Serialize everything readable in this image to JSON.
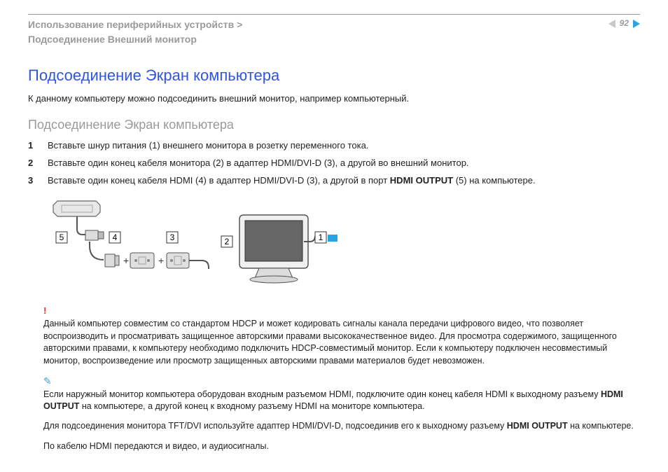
{
  "header": {
    "breadcrumb_line1": "Использование периферийных устройств >",
    "breadcrumb_line2": "Подсоединение Внешний монитор",
    "page_number": "92"
  },
  "title": "Подсоединение Экран компьютера",
  "intro": "К данному компьютеру можно подсоединить внешний монитор, например компьютерный.",
  "subtitle": "Подсоединение Экран компьютера",
  "steps": [
    {
      "n": "1",
      "text": "Вставьте шнур питания (1) внешнего монитора в розетку переменного тока."
    },
    {
      "n": "2",
      "text": "Вставьте один конец кабеля монитора (2) в адаптер HDMI/DVI-D (3), а другой во внешний монитор."
    },
    {
      "n": "3",
      "text_before": "Вставьте один конец кабеля HDMI (4) в адаптер HDMI/DVI-D (3), а другой в порт ",
      "bold": "HDMI OUTPUT",
      "text_after": " (5) на компьютере."
    }
  ],
  "diagram": {
    "labels": {
      "l1": "1",
      "l2": "2",
      "l3": "3",
      "l4": "4",
      "l5": "5"
    }
  },
  "warning": "Данный компьютер совместим со стандартом HDCP и может кодировать сигналы канала передачи цифрового видео, что позволяет воспроизводить и просматривать защищенное авторскими правами высококачественное видео. Для просмотра содержимого, защищенного авторскими правами, к компьютеру необходимо подключить HDCP-совместимый монитор. Если к компьютеру подключен несовместимый монитор, воспроизведение или просмотр защищенных авторскими правами материалов будет невозможен.",
  "note1_before": "Если наружный монитор компьютера оборудован входным разъемом HDMI, подключите один конец кабеля HDMI к выходному разъему ",
  "note1_bold1": "HDMI OUTPUT",
  "note1_mid": " на компьютере, а другой конец к входному разъему HDMI на мониторе компьютера.",
  "note2_before": "Для подсоединения монитора TFT/DVI используйте адаптер HDMI/DVI-D, подсоединив его к выходному разъему ",
  "note2_bold": "HDMI OUTPUT",
  "note2_after": " на компьютере.",
  "note3": "По кабелю HDMI передаются и видео, и аудиосигналы."
}
